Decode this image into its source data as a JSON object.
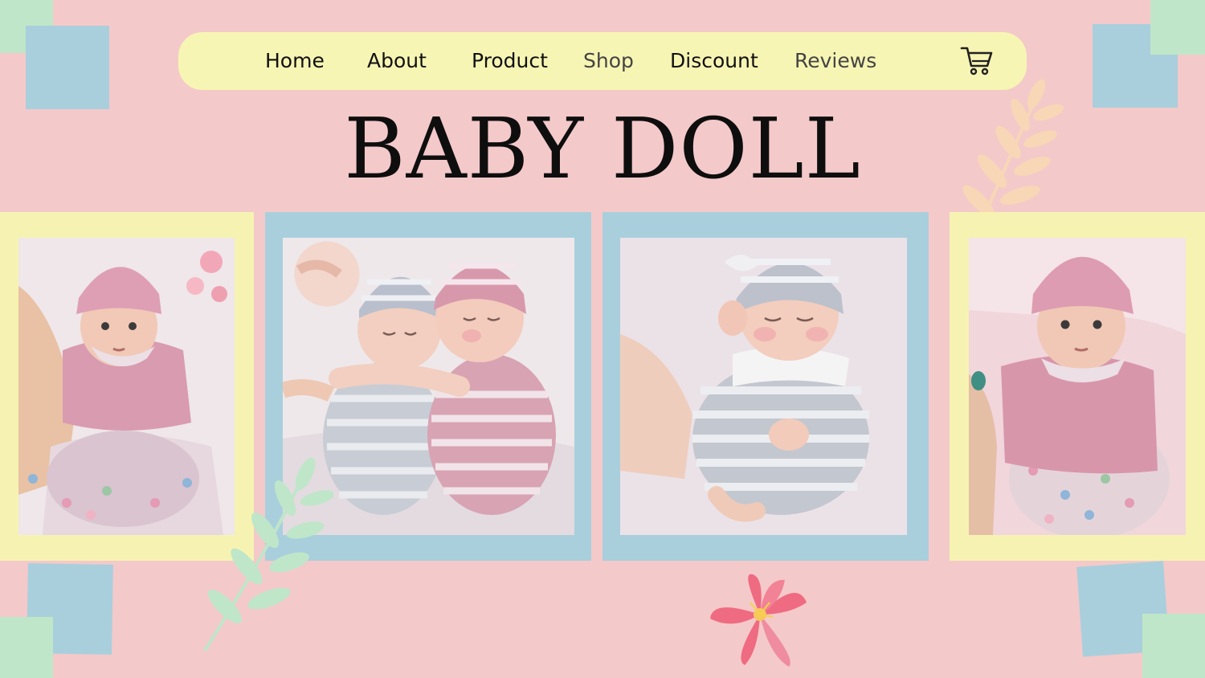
{
  "nav": {
    "items": [
      {
        "label": "Home",
        "muted": false
      },
      {
        "label": "About",
        "muted": false
      },
      {
        "label": "Product",
        "muted": false
      },
      {
        "label": "Shop",
        "muted": true
      },
      {
        "label": "Discount",
        "muted": false
      },
      {
        "label": "Reviews",
        "muted": true
      }
    ],
    "cart_icon": "shopping-cart-icon"
  },
  "hero": {
    "title": "BABY DOLL"
  },
  "gallery": [
    {
      "frame_color": "#f6f3b2",
      "description_icon": "baby-doll-pink-knit-photo"
    },
    {
      "frame_color": "#a9cfdd",
      "description_icon": "twin-baby-dolls-photo"
    },
    {
      "frame_color": "#a9cfdd",
      "description_icon": "sleeping-baby-doll-photo"
    },
    {
      "frame_color": "#f6f3b2",
      "description_icon": "baby-doll-held-photo"
    }
  ],
  "colors": {
    "background": "#f4c9c9",
    "nav_background": "#f7f5b4",
    "blue_square": "#a9cfdd",
    "green_square": "#bfe6c9",
    "yellow_frame": "#f6f3b2"
  }
}
